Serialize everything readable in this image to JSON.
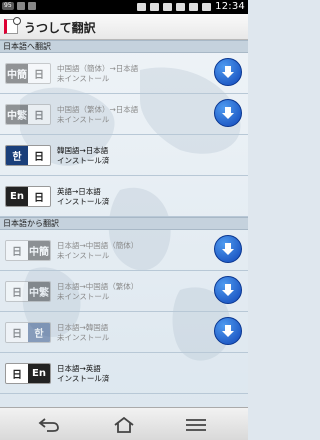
{
  "status_bar": {
    "badge": "95",
    "time": "12:34"
  },
  "title_bar": {
    "title": "うつして翻訳"
  },
  "sections": [
    {
      "header": "日本語へ翻訳",
      "items": [
        {
          "source": "中簡",
          "target": "日",
          "line1": "中国語（簡体）→日本語",
          "line2": "未インストール",
          "installed": false
        },
        {
          "source": "中繁",
          "target": "日",
          "line1": "中国語（繁体）→日本語",
          "line2": "未インストール",
          "installed": false
        },
        {
          "source": "한",
          "target": "日",
          "line1": "韓国語→日本語",
          "line2": "インストール済",
          "installed": true
        },
        {
          "source": "En",
          "target": "日",
          "line1": "英語→日本語",
          "line2": "インストール済",
          "installed": true
        }
      ]
    },
    {
      "header": "日本語から翻訳",
      "items": [
        {
          "source": "日",
          "target": "中簡",
          "line1": "日本語→中国語（簡体）",
          "line2": "未インストール",
          "installed": false
        },
        {
          "source": "日",
          "target": "中繁",
          "line1": "日本語→中国語（繁体）",
          "line2": "未インストール",
          "installed": false
        },
        {
          "source": "日",
          "target": "한",
          "line1": "日本語→韓国語",
          "line2": "未インストール",
          "installed": false
        },
        {
          "source": "日",
          "target": "En",
          "line1": "日本語→英語",
          "line2": "インストール済",
          "installed": true
        }
      ]
    }
  ],
  "colors": {
    "download_button": "#1a5fd0",
    "section_header": "#c5d2dd",
    "lang_dark": "#222222",
    "lang_blue": "#1a3f7a"
  },
  "icons": {
    "download": "download-arrow-icon",
    "back": "back-arrow-icon",
    "home": "home-icon",
    "menu": "menu-icon"
  }
}
